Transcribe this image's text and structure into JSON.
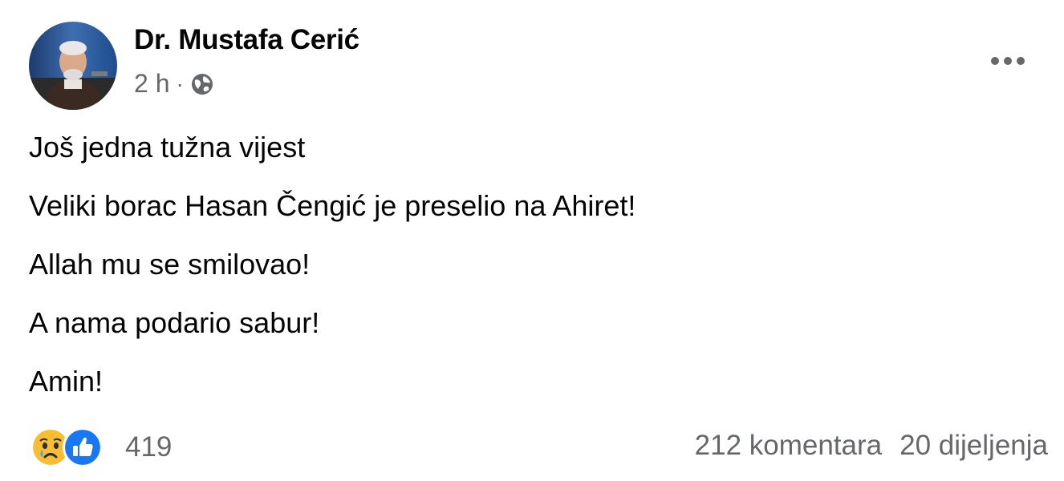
{
  "post": {
    "author": "Dr. Mustafa Cerić",
    "timestamp": "2 h",
    "separator": "·",
    "audience_icon": "globe-icon",
    "more_icon": "more-options-icon",
    "lines": [
      "Još jedna tužna vijest",
      "Veliki borac Hasan Čengić je preselio na Ahiret!",
      "Allah mu se smilovao!",
      "A nama podario sabur!",
      "Amin!"
    ]
  },
  "reactions": {
    "icons": [
      "sad-reaction-icon",
      "like-reaction-icon"
    ],
    "count": "419",
    "comments": "212 komentara",
    "shares": "20 dijeljenja"
  },
  "colors": {
    "text": "#050505",
    "secondary": "#65676b",
    "like_blue": "#1877f2",
    "sad_yellow": "#f7b125"
  }
}
